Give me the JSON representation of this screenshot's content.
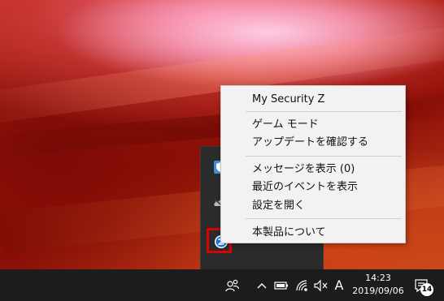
{
  "context_menu": {
    "items": [
      {
        "label": "My Security Z"
      },
      {
        "label": "ゲーム モード"
      },
      {
        "label": "アップデートを確認する"
      },
      {
        "label": "メッセージを表示 (0)"
      },
      {
        "label": "最近のイベントを表示"
      },
      {
        "label": "設定を開く"
      },
      {
        "label": "本製品について"
      }
    ]
  },
  "tray_flyout": {
    "icons": [
      "shield-icon",
      "cloud-icon",
      "my-security-z-icon"
    ],
    "highlight_color": "#e00000"
  },
  "taskbar": {
    "clock": {
      "time": "14:23",
      "date": "2019/09/06"
    },
    "ime_label": "A",
    "notification_count": "14"
  },
  "colors": {
    "menu_bg": "#f2f2f2",
    "taskbar_bg": "#1c1c1c",
    "flyout_bg": "#2b2b2b"
  }
}
